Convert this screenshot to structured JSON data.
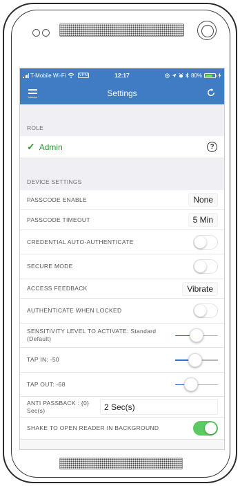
{
  "status_bar": {
    "carrier": "T-Mobile Wi-Fi",
    "vpn": "VPN",
    "time": "12:17",
    "battery": "80%",
    "battery_level": 0.8
  },
  "nav": {
    "title": "Settings"
  },
  "role": {
    "header": "ROLE",
    "selected": "Admin",
    "help": "?"
  },
  "device": {
    "header": "DEVICE SETTINGS",
    "passcode_enable": {
      "label": "PASSCODE ENABLE",
      "value": "None"
    },
    "passcode_timeout": {
      "label": "PASSCODE TIMEOUT",
      "value": "5 Min"
    },
    "credential_auto_auth": {
      "label": "CREDENTIAL AUTO-AUTHENTICATE",
      "on": false
    },
    "secure_mode": {
      "label": "SECURE MODE",
      "on": false
    },
    "access_feedback": {
      "label": "ACCESS FEEDBACK",
      "value": "Vibrate"
    },
    "auth_when_locked": {
      "label": "AUTHENTICATE WHEN LOCKED",
      "on": false
    },
    "sensitivity": {
      "label": "SENSITIVITY LEVEL TO ACTIVATE: Standard (Default)",
      "level": 0.5
    },
    "tap_in": {
      "label": "TAP IN: -50",
      "level": 0.45
    },
    "tap_out": {
      "label": "TAP OUT: -68",
      "level": 0.3
    },
    "anti_passback": {
      "label": "ANTI PASSBACK : {0} Sec(s)",
      "value": "2 Sec(s)"
    },
    "shake_to_open": {
      "label": "SHAKE TO OPEN READER IN BACKGROUND",
      "on": true
    }
  },
  "colors": {
    "brand_blue": "#3f7cc4",
    "check_green": "#2e9a33",
    "toggle_on": "#5cca63",
    "slider_blue": "#2f6fd0"
  },
  "icons": {
    "menu": "hamburger-icon",
    "refresh": "refresh-icon",
    "check": "checkmark-icon",
    "help": "help-circle-icon"
  }
}
